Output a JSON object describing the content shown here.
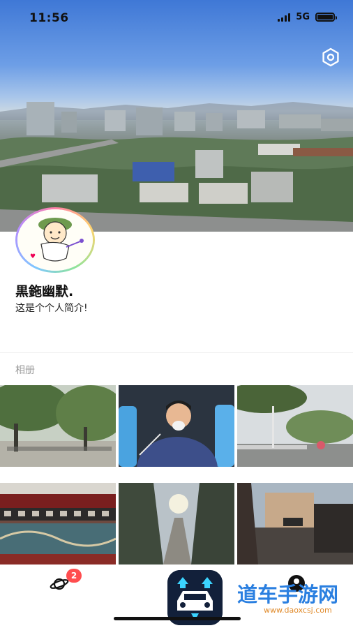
{
  "status_bar": {
    "time": "11:56",
    "network": "5G",
    "battery_level": 1.0
  },
  "cover": {
    "description_icon": "city-skyline-photo"
  },
  "header": {
    "settings_icon": "hexagon-settings-icon"
  },
  "profile": {
    "name": "黒鉇幽默.",
    "bio": "这是个个人简介!",
    "avatar_icon": "cartoon-avatar"
  },
  "album": {
    "label": "相册",
    "photos": [
      "park-trees-photo",
      "hospital-portrait-photo",
      "street-park-photo",
      "temple-eaves-photo",
      "sunlit-alley-photo",
      "courtyard-evening-photo"
    ]
  },
  "tabbar": {
    "planet_icon": "planet-icon",
    "badge_count": "2",
    "profile_icon": "profile-icon"
  },
  "watermark": {
    "text": "道车手游网",
    "subtext": "www.daoxcsj.com"
  },
  "colors": {
    "badge": "#ff4d4f",
    "logo_bg": "#12203a",
    "logo_accent": "#3bd4ff"
  }
}
